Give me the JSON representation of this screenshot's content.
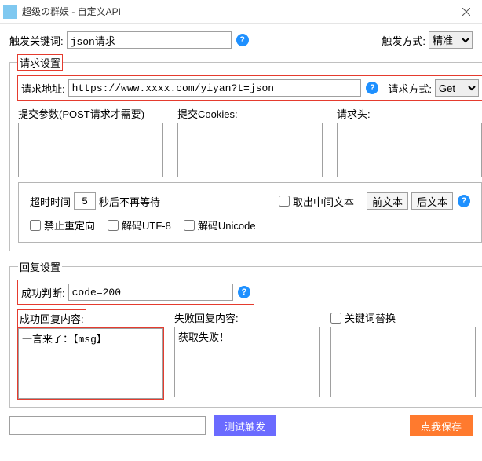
{
  "window": {
    "title": "超级の群娱 - 自定义API"
  },
  "trigger": {
    "keyword_label": "触发关键词:",
    "keyword_value": "json请求",
    "mode_label": "触发方式:",
    "mode_value": "精准"
  },
  "request": {
    "group_title": "请求设置",
    "url_label": "请求地址:",
    "url_value": "https://www.xxxx.com/yiyan?t=json",
    "method_label": "请求方式:",
    "method_value": "Get",
    "params_label": "提交参数(POST请求才需要)",
    "cookies_label": "提交Cookies:",
    "headers_label": "请求头:",
    "params_value": "",
    "cookies_value": "",
    "headers_value": "",
    "timeout_pre": "超时时间",
    "timeout_value": "5",
    "timeout_post": "秒后不再等待",
    "extract_middle_label": "取出中间文本",
    "front_btn": "前文本",
    "back_btn": "后文本",
    "no_redirect_label": "禁止重定向",
    "decode_utf8_label": "解码UTF-8",
    "decode_unicode_label": "解码Unicode"
  },
  "reply": {
    "group_title": "回复设置",
    "success_check_label": "成功判断:",
    "success_check_value": "code=200",
    "success_content_label": "成功回复内容:",
    "success_content_value": "一言来了：【msg】",
    "fail_content_label": "失败回复内容:",
    "fail_content_value": "获取失败！",
    "keyword_replace_label": "关键词替换",
    "keyword_replace_value": ""
  },
  "bottom": {
    "test_input_value": "",
    "test_btn": "测试触发",
    "save_btn": "点我保存"
  }
}
